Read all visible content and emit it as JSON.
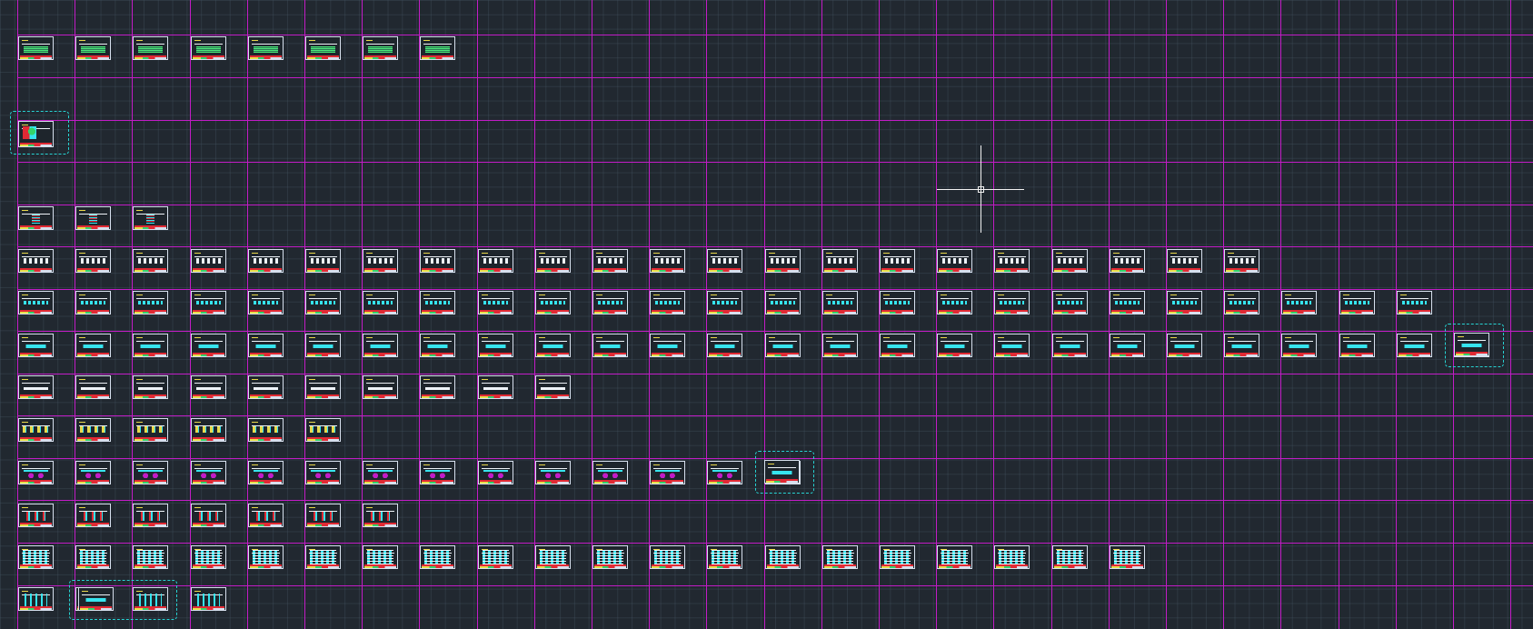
{
  "view": {
    "background_color": "#212830",
    "grid_color": "#465664",
    "frame_line_color": "#c21cc6",
    "sheet_border_color": "#d7e0ee",
    "selection_color": "#27d3d3",
    "crosshair_color": "#f2f2f2"
  },
  "drawing_rows": [
    {
      "sheet_count": 8,
      "style": "t1"
    },
    {
      "sheet_count": 1,
      "style": "t10"
    },
    {
      "sheet_count": 3,
      "style": "t2"
    },
    {
      "sheet_count": 22,
      "style": "t3"
    },
    {
      "sheet_count": 25,
      "style": "t4"
    },
    {
      "sheet_count": 26,
      "style": "t5"
    },
    {
      "sheet_count": 10,
      "style": "t6"
    },
    {
      "sheet_count": 6,
      "style": "t13"
    },
    {
      "sheet_count": 14,
      "style": "t7"
    },
    {
      "sheet_count": 7,
      "style": "t8"
    },
    {
      "sheet_count": 20,
      "style": "t9"
    },
    {
      "sheet_count": 4,
      "style": "t12"
    }
  ],
  "selection": {
    "selected_sheet_count": 5
  },
  "cursor": {
    "icon": "crosshair-cursor-icon"
  }
}
